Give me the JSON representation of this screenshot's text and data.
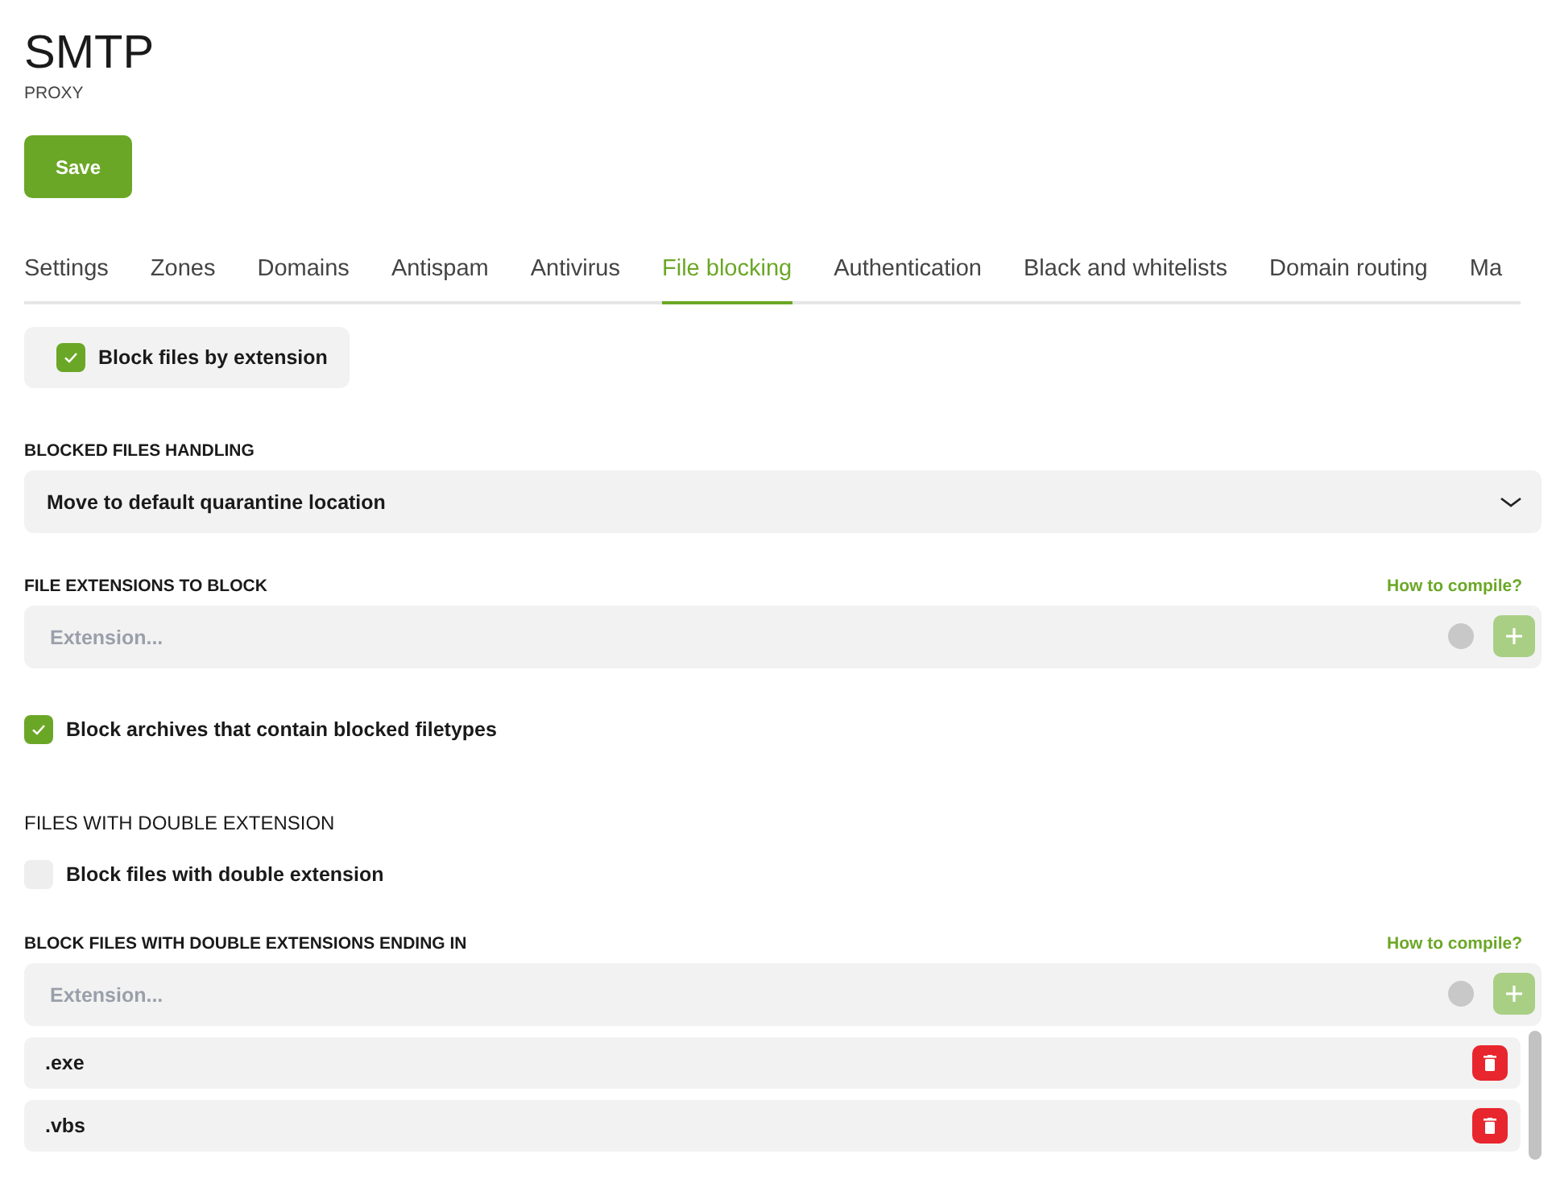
{
  "header": {
    "title": "SMTP",
    "subtitle": "PROXY"
  },
  "save_button": "Save",
  "tabs": [
    {
      "label": "Settings",
      "selected": false
    },
    {
      "label": "Zones",
      "selected": false
    },
    {
      "label": "Domains",
      "selected": false
    },
    {
      "label": "Antispam",
      "selected": false
    },
    {
      "label": "Antivirus",
      "selected": false
    },
    {
      "label": "File blocking",
      "selected": true
    },
    {
      "label": "Authentication",
      "selected": false
    },
    {
      "label": "Black and whitelists",
      "selected": false
    },
    {
      "label": "Domain routing",
      "selected": false
    },
    {
      "label": "Ma",
      "selected": false
    }
  ],
  "block_by_extension": {
    "label": "Block files by extension",
    "checked": true
  },
  "handling": {
    "label": "BLOCKED FILES HANDLING",
    "value": "Move to default quarantine location"
  },
  "extensions_to_block": {
    "label": "FILE EXTENSIONS TO BLOCK",
    "help_link": "How to compile?",
    "placeholder": "Extension..."
  },
  "block_archives": {
    "label": "Block archives that contain blocked filetypes",
    "checked": true
  },
  "double_extension": {
    "heading": "FILES WITH DOUBLE EXTENSION",
    "checkbox": {
      "label": "Block files with double extension",
      "checked": false
    },
    "list_label": "BLOCK FILES WITH DOUBLE EXTENSIONS ENDING IN",
    "help_link": "How to compile?",
    "placeholder": "Extension...",
    "items": [
      ".exe",
      ".vbs"
    ]
  }
}
